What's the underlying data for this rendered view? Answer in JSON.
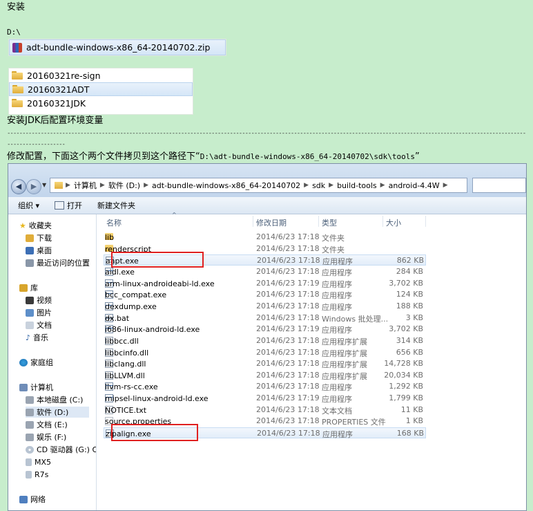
{
  "notes": {
    "install": "安装",
    "drive": "D:\\",
    "zip_file": "adt-bundle-windows-x86_64-20140702.zip",
    "folders": [
      "20160321re-sign",
      "20160321ADT",
      "20160321JDK"
    ],
    "jdk_note": "安装JDK后配置环境变量",
    "dash_line_1": "-------------------------------------------------------------------------------------------------------------------------------------------------------------------------------------------------------------------------------------------------------",
    "dash_line_2": "-------------------",
    "copy_note_prefix": "修改配置，下面这个两个文件拷贝到这个路径下“",
    "copy_note_path": "D:\\adt-bundle-windows-x86_64-20140702\\sdk\\tools",
    "copy_note_suffix": "”"
  },
  "explorer": {
    "breadcrumb": [
      "计算机",
      "软件 (D:)",
      "adt-bundle-windows-x86_64-20140702",
      "sdk",
      "build-tools",
      "android-4.4W"
    ],
    "toolbar": {
      "organize": "组织 ▾",
      "open": "打开",
      "new_folder": "新建文件夹"
    },
    "nav": {
      "favorites": "收藏夹",
      "downloads": "下载",
      "desktop": "桌面",
      "recent": "最近访问的位置",
      "libraries": "库",
      "videos": "视频",
      "pictures": "图片",
      "documents": "文档",
      "music": "音乐",
      "homegroup": "家庭组",
      "computer": "计算机",
      "drives": [
        "本地磁盘 (C:)",
        "软件 (D:)",
        "文档 (E:)",
        "娱乐 (F:)",
        "CD 驱动器 (G:) OPP",
        "MX5",
        "R7s"
      ],
      "network": "网络"
    },
    "columns": {
      "name": "名称",
      "modified": "修改日期",
      "type": "类型",
      "size": "大小"
    },
    "files": [
      {
        "name": "lib",
        "date": "2014/6/23 17:18",
        "type": "文件夹",
        "size": "",
        "icon": "folder"
      },
      {
        "name": "renderscript",
        "date": "2014/6/23 17:18",
        "type": "文件夹",
        "size": "",
        "icon": "folder"
      },
      {
        "name": "aapt.exe",
        "date": "2014/6/23 17:18",
        "type": "应用程序",
        "size": "862 KB",
        "icon": "exe"
      },
      {
        "name": "aidl.exe",
        "date": "2014/6/23 17:18",
        "type": "应用程序",
        "size": "284 KB",
        "icon": "exe"
      },
      {
        "name": "arm-linux-androideabi-ld.exe",
        "date": "2014/6/23 17:19",
        "type": "应用程序",
        "size": "3,702 KB",
        "icon": "exe"
      },
      {
        "name": "bcc_compat.exe",
        "date": "2014/6/23 17:18",
        "type": "应用程序",
        "size": "124 KB",
        "icon": "exe"
      },
      {
        "name": "dexdump.exe",
        "date": "2014/6/23 17:18",
        "type": "应用程序",
        "size": "188 KB",
        "icon": "exe"
      },
      {
        "name": "dx.bat",
        "date": "2014/6/23 17:18",
        "type": "Windows 批处理...",
        "size": "3 KB",
        "icon": "bat"
      },
      {
        "name": "i686-linux-android-ld.exe",
        "date": "2014/6/23 17:19",
        "type": "应用程序",
        "size": "3,702 KB",
        "icon": "exe"
      },
      {
        "name": "libbcc.dll",
        "date": "2014/6/23 17:18",
        "type": "应用程序扩展",
        "size": "314 KB",
        "icon": "dll"
      },
      {
        "name": "libbcinfo.dll",
        "date": "2014/6/23 17:18",
        "type": "应用程序扩展",
        "size": "656 KB",
        "icon": "dll"
      },
      {
        "name": "libclang.dll",
        "date": "2014/6/23 17:18",
        "type": "应用程序扩展",
        "size": "14,728 KB",
        "icon": "dll"
      },
      {
        "name": "libLLVM.dll",
        "date": "2014/6/23 17:18",
        "type": "应用程序扩展",
        "size": "20,034 KB",
        "icon": "dll"
      },
      {
        "name": "llvm-rs-cc.exe",
        "date": "2014/6/23 17:18",
        "type": "应用程序",
        "size": "1,292 KB",
        "icon": "exe"
      },
      {
        "name": "mipsel-linux-android-ld.exe",
        "date": "2014/6/23 17:19",
        "type": "应用程序",
        "size": "1,799 KB",
        "icon": "exe"
      },
      {
        "name": "NOTICE.txt",
        "date": "2014/6/23 17:18",
        "type": "文本文档",
        "size": "11 KB",
        "icon": "txt"
      },
      {
        "name": "source.properties",
        "date": "2014/6/23 17:18",
        "type": "PROPERTIES 文件",
        "size": "1 KB",
        "icon": "prop"
      },
      {
        "name": "zipalign.exe",
        "date": "2014/6/23 17:18",
        "type": "应用程序",
        "size": "168 KB",
        "icon": "exe"
      }
    ]
  },
  "colors": {
    "page_bg": "#c7edcc",
    "highlight": "#e02020",
    "selection": "#e2edf9"
  }
}
